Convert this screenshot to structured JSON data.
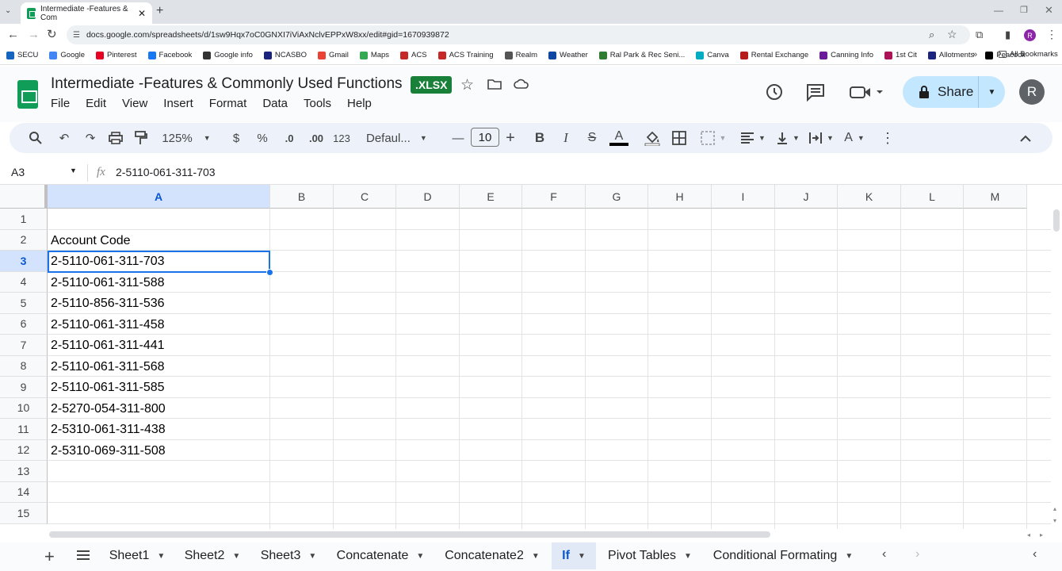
{
  "browser": {
    "tab_title": "Intermediate -Features & Com",
    "url": "docs.google.com/spreadsheets/d/1sw9Hqx7oC0GNXI7iViAxNclvEPPxW8xx/edit#gid=1670939872",
    "bookmarks": [
      "SECU",
      "Google",
      "Pinterest",
      "Facebook",
      "Google info",
      "NCASBO",
      "Gmail",
      "Maps",
      "ACS",
      "ACS Training",
      "Realm",
      "Weather",
      "Ral Park & Rec Seni...",
      "Canva",
      "Rental Exchange",
      "Canning Info",
      "1st Cit",
      "Allotments",
      "Peacock"
    ],
    "all_bookmarks": "All Bookmarks",
    "profile_initial": "R"
  },
  "app": {
    "title": "Intermediate -Features & Commonly Used Functions",
    "badge": ".XLSX",
    "menus": [
      "File",
      "Edit",
      "View",
      "Insert",
      "Format",
      "Data",
      "Tools",
      "Help"
    ],
    "share_label": "Share",
    "avatar_initial": "R"
  },
  "toolbar": {
    "zoom": "125%",
    "currency": "$",
    "percent": "%",
    "dec_decrease": ".0",
    "dec_increase": ".00",
    "number_format": "123",
    "font": "Defaul...",
    "font_size": "10"
  },
  "formula_bar": {
    "cell_ref": "A3",
    "fx": "fx",
    "value": "2-5110-061-311-703"
  },
  "grid": {
    "columns": [
      "A",
      "B",
      "C",
      "D",
      "E",
      "F",
      "G",
      "H",
      "I",
      "J",
      "K",
      "L",
      "M"
    ],
    "rows": [
      "1",
      "2",
      "3",
      "4",
      "5",
      "6",
      "7",
      "8",
      "9",
      "10",
      "11",
      "12",
      "13",
      "14",
      "15"
    ],
    "column_a": [
      "",
      "Account Code",
      "2-5110-061-311-703",
      "2-5110-061-311-588",
      "2-5110-856-311-536",
      "2-5110-061-311-458",
      "2-5110-061-311-441",
      "2-5110-061-311-568",
      "2-5110-061-311-585",
      "2-5270-054-311-800",
      "2-5310-061-311-438",
      "2-5310-069-311-508",
      "",
      "",
      ""
    ],
    "selected_cell": "A3"
  },
  "sheets": {
    "tabs": [
      "Sheet1",
      "Sheet2",
      "Sheet3",
      "Concatenate",
      "Concatenate2",
      "If",
      "Pivot Tables",
      "Conditional Formating"
    ],
    "active": "If"
  }
}
